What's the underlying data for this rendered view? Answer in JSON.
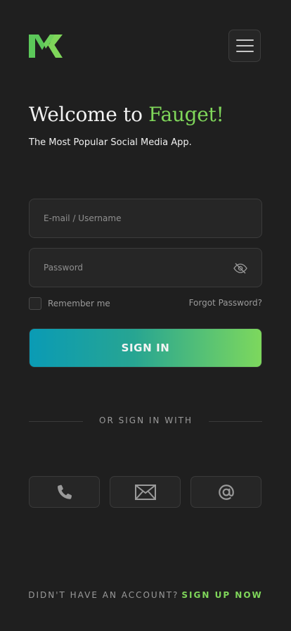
{
  "header": {
    "logo_icon": "mk-logo-icon",
    "menu_icon": "hamburger-menu-icon"
  },
  "welcome": {
    "title_prefix": "Welcome to ",
    "title_brand": "Fauget!",
    "subtitle": "The Most Popular Social Media App."
  },
  "form": {
    "username_placeholder": "E-mail / Username",
    "username_value": "",
    "password_placeholder": "Password",
    "password_value": "",
    "password_toggle_icon": "eye-slash-icon",
    "remember_label": "Remember me",
    "remember_checked": false,
    "forgot_label": "Forgot Password?",
    "signin_label": "SIGN IN"
  },
  "alt_signin": {
    "divider_label": "OR SIGN IN WITH",
    "options": [
      {
        "icon": "phone-icon"
      },
      {
        "icon": "envelope-icon"
      },
      {
        "icon": "at-sign-icon"
      }
    ]
  },
  "footer": {
    "question": "DIDN'T HAVE AN ACCOUNT?",
    "link_label": "SIGN UP NOW"
  },
  "colors": {
    "background": "#1f1f1f",
    "accent": "#7fd65a",
    "gradient_start": "#0a9bb5",
    "gradient_end": "#7dd85d"
  }
}
